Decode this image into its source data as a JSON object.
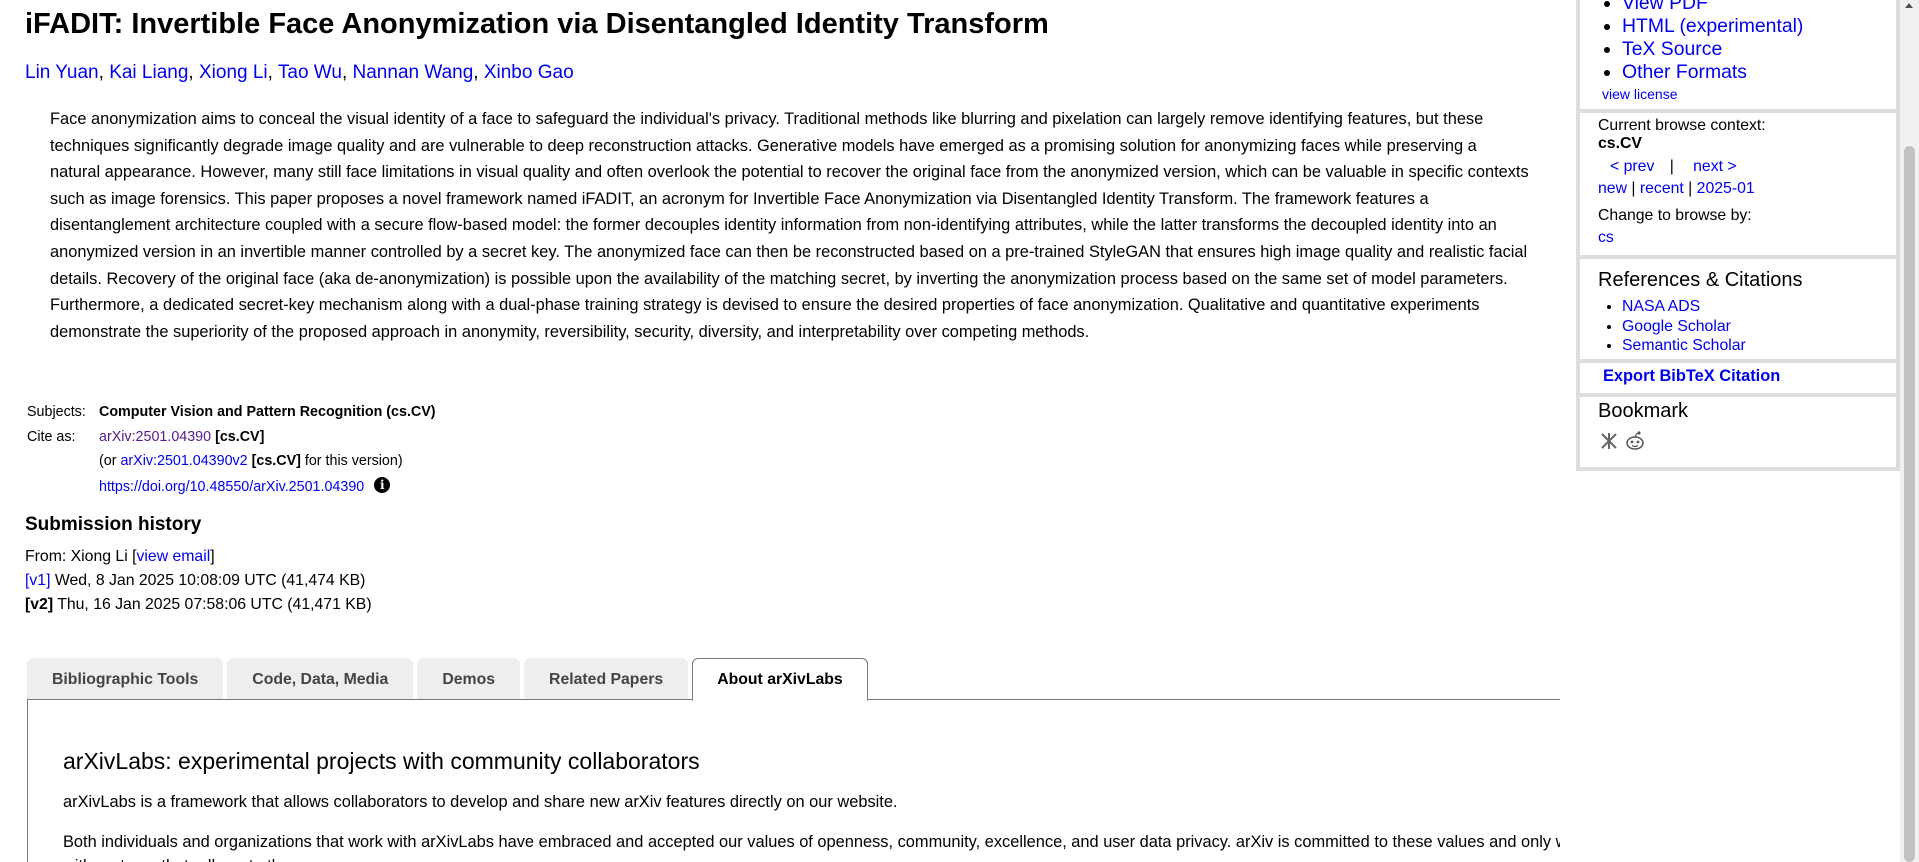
{
  "paper": {
    "title": "iFADIT: Invertible Face Anonymization via Disentangled Identity Transform",
    "authors": [
      "Lin Yuan",
      "Kai Liang",
      "Xiong Li",
      "Tao Wu",
      "Nannan Wang",
      "Xinbo Gao"
    ],
    "abstract": "Face anonymization aims to conceal the visual identity of a face to safeguard the individual's privacy. Traditional methods like blurring and pixelation can largely remove identifying features, but these techniques significantly degrade image quality and are vulnerable to deep reconstruction attacks. Generative models have emerged as a promising solution for anonymizing faces while preserving a natural appearance. However, many still face limitations in visual quality and often overlook the potential to recover the original face from the anonymized version, which can be valuable in specific contexts such as image forensics. This paper proposes a novel framework named iFADIT, an acronym for Invertible Face Anonymization via Disentangled Identity Transform. The framework features a disentanglement architecture coupled with a secure flow-based model: the former decouples identity information from non-identifying attributes, while the latter transforms the decoupled identity into an anonymized version in an invertible manner controlled by a secret key. The anonymized face can then be reconstructed based on a pre-trained StyleGAN that ensures high image quality and realistic facial details. Recovery of the original face (aka de-anonymization) is possible upon the availability of the matching secret, by inverting the anonymization process based on the same set of model parameters. Furthermore, a dedicated secret-key mechanism along with a dual-phase training strategy is devised to ensure the desired properties of face anonymization. Qualitative and quantitative experiments demonstrate the superiority of the proposed approach in anonymity, reversibility, security, diversity, and interpretability over competing methods.",
    "subjects_label": "Subjects:",
    "subjects_value": "Computer Vision and Pattern Recognition (cs.CV)",
    "cite_label": "Cite as:",
    "cite_id": "arXiv:2501.04390",
    "cite_cat": "[cs.CV]",
    "cite_v_prefix": "(or ",
    "cite_v_id": "arXiv:2501.04390v2",
    "cite_v_cat": "[cs.CV]",
    "cite_v_suffix": " for this version)",
    "doi": "https://doi.org/10.48550/arXiv.2501.04390",
    "info_glyph": "i"
  },
  "submission": {
    "heading": "Submission history",
    "from_prefix": "From: Xiong Li [",
    "view_email": "view email",
    "from_suffix": "]",
    "v1_label": "[v1]",
    "v1_text": " Wed, 8 Jan 2025 10:08:09 UTC (41,474 KB)",
    "v2_label": "[v2]",
    "v2_text": " Thu, 16 Jan 2025 07:58:06 UTC (41,471 KB)"
  },
  "tabs": [
    {
      "label": "Bibliographic Tools",
      "active": false
    },
    {
      "label": "Code, Data, Media",
      "active": false
    },
    {
      "label": "Demos",
      "active": false
    },
    {
      "label": "Related Papers",
      "active": false
    },
    {
      "label": "About arXivLabs",
      "active": true
    }
  ],
  "labs": {
    "title": "arXivLabs: experimental projects with community collaborators",
    "p1": "arXivLabs is a framework that allows collaborators to develop and share new arXiv features directly on our website.",
    "p2": "Both individuals and organizations that work with arXivLabs have embraced and accepted our values of openness, community, excellence, and user data privacy. arXiv is committed to these values and only works with partners that adhere to them."
  },
  "sidebar": {
    "formats": [
      "View PDF",
      "HTML (experimental)",
      "TeX Source",
      "Other Formats"
    ],
    "view_license": "view license",
    "context_label": "Current browse context:",
    "context_value": "cs.CV",
    "prev": "< prev",
    "divider": "|",
    "next": "next >",
    "new": "new",
    "recent": "recent",
    "month": "2025-01",
    "change_label": "Change to browse by:",
    "change_value": "cs",
    "refs_heading": "References & Citations",
    "refs": [
      "NASA ADS",
      "Google Scholar",
      "Semantic Scholar"
    ],
    "bibtex": "Export BibTeX Citation",
    "bookmark_heading": "Bookmark",
    "bookmark_icons": [
      "bibsonomy-icon",
      "reddit-icon"
    ]
  },
  "colors": {
    "link": "#0000ee",
    "visited": "#551a8b",
    "sidebar_border": "#dddddd",
    "tab_bg": "#eeeeee",
    "flask_yellow": "#f4cf1d"
  }
}
